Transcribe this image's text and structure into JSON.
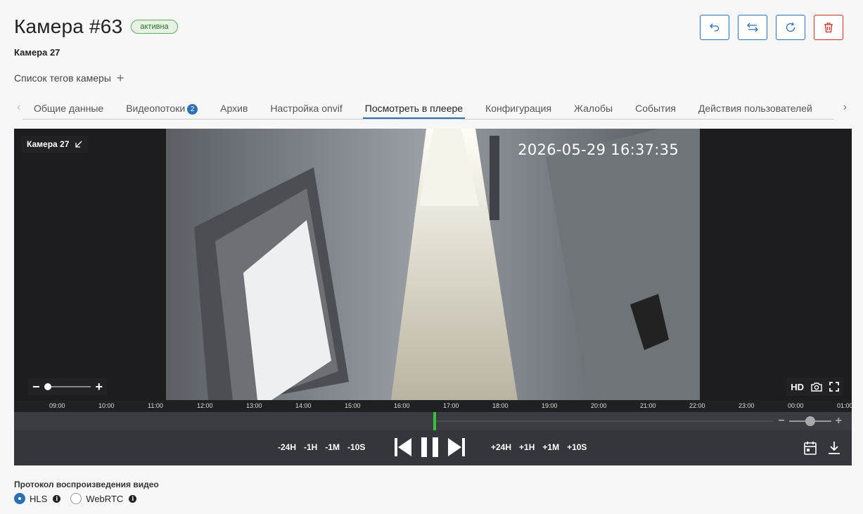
{
  "header": {
    "title": "Камера #63",
    "status": "активна",
    "subtitle": "Камера 27",
    "tags_label": "Список тегов камеры",
    "tags_add_icon": "+"
  },
  "actions": [
    {
      "icon": "undo-icon",
      "color": "#2b6fb5"
    },
    {
      "icon": "swap-icon",
      "color": "#2b6fb5"
    },
    {
      "icon": "refresh-icon",
      "color": "#2b6fb5"
    },
    {
      "icon": "trash-icon",
      "color": "#c9302c"
    }
  ],
  "tabs": {
    "items": [
      {
        "label": "Общие данные"
      },
      {
        "label": "Видеопотоки",
        "badge": "2"
      },
      {
        "label": "Архив"
      },
      {
        "label": "Настройка onvif"
      },
      {
        "label": "Посмотреть в плеере",
        "active": true
      },
      {
        "label": "Конфигурация"
      },
      {
        "label": "Жалобы"
      },
      {
        "label": "События"
      },
      {
        "label": "Действия пользователей"
      }
    ],
    "prev_icon": "‹",
    "next_icon": "›"
  },
  "player": {
    "camera_label": "Камера 27",
    "timestamp": "2026-05-29 16:37:35",
    "quality": "HD",
    "zoom_minus": "−",
    "zoom_plus": "+",
    "timeline": {
      "hours": [
        "09:00",
        "10:00",
        "11:00",
        "12:00",
        "13:00",
        "14:00",
        "15:00",
        "16:00",
        "17:00",
        "18:00",
        "19:00",
        "20:00",
        "21:00",
        "22:00",
        "23:00",
        "00:00",
        "01:00"
      ]
    },
    "rewind": [
      "-24H",
      "-1H",
      "-1M",
      "-10S"
    ],
    "forward": [
      "+24H",
      "+1H",
      "+1M",
      "+10S"
    ]
  },
  "protocol": {
    "title": "Протокол воспроизведения видео",
    "options": [
      {
        "label": "HLS",
        "checked": true
      },
      {
        "label": "WebRTC",
        "checked": false
      }
    ],
    "info_icon": "i"
  },
  "colors": {
    "accent": "#2b6fb5",
    "danger": "#c9302c",
    "status_green": "#5cad5c",
    "timeline_cursor": "#37c23b"
  }
}
